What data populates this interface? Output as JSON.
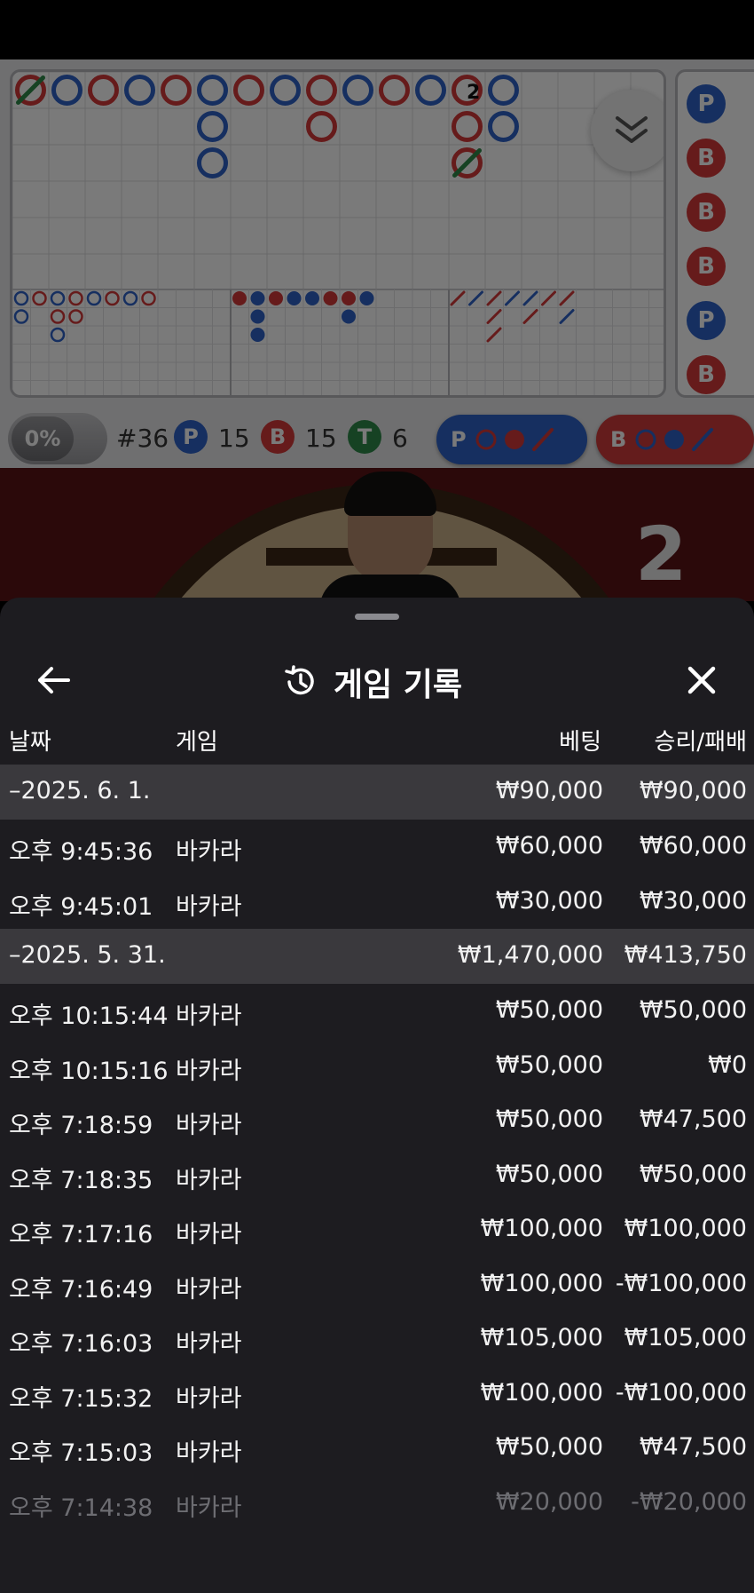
{
  "stats": {
    "percent": "0%",
    "round": "#36",
    "player_letter": "P",
    "player_count": "15",
    "banker_letter": "B",
    "banker_count": "15",
    "tie_letter": "T",
    "tie_count": "6"
  },
  "predict": {
    "player_label": "P",
    "banker_label": "B"
  },
  "road": {
    "tie_count_label": "2",
    "side_column": [
      "P",
      "B",
      "B",
      "B",
      "P",
      "B"
    ]
  },
  "video": {
    "countdown": "2"
  },
  "panel": {
    "title": "게임 기록",
    "columns": {
      "date": "날짜",
      "game": "게임",
      "bet": "베팅",
      "result": "승리/패배"
    },
    "rows": [
      {
        "type": "group",
        "date": "–2025. 6. 1.",
        "game": "",
        "bet": "₩90,000",
        "result": "₩90,000"
      },
      {
        "type": "item",
        "date": "오후 9:45:36",
        "game": "바카라",
        "bet": "₩60,000",
        "result": "₩60,000"
      },
      {
        "type": "item",
        "date": "오후 9:45:01",
        "game": "바카라",
        "bet": "₩30,000",
        "result": "₩30,000"
      },
      {
        "type": "group",
        "date": "–2025. 5. 31.",
        "game": "",
        "bet": "₩1,470,000",
        "result": "₩413,750"
      },
      {
        "type": "item",
        "date": "오후 10:15:44",
        "game": "바카라",
        "bet": "₩50,000",
        "result": "₩50,000"
      },
      {
        "type": "item",
        "date": "오후 10:15:16",
        "game": "바카라",
        "bet": "₩50,000",
        "result": "₩0"
      },
      {
        "type": "item",
        "date": "오후 7:18:59",
        "game": "바카라",
        "bet": "₩50,000",
        "result": "₩47,500"
      },
      {
        "type": "item",
        "date": "오후 7:18:35",
        "game": "바카라",
        "bet": "₩50,000",
        "result": "₩50,000"
      },
      {
        "type": "item",
        "date": "오후 7:17:16",
        "game": "바카라",
        "bet": "₩100,000",
        "result": "₩100,000"
      },
      {
        "type": "item",
        "date": "오후 7:16:49",
        "game": "바카라",
        "bet": "₩100,000",
        "result": "-₩100,000"
      },
      {
        "type": "item",
        "date": "오후 7:16:03",
        "game": "바카라",
        "bet": "₩105,000",
        "result": "₩105,000"
      },
      {
        "type": "item",
        "date": "오후 7:15:32",
        "game": "바카라",
        "bet": "₩100,000",
        "result": "-₩100,000"
      },
      {
        "type": "item",
        "date": "오후 7:15:03",
        "game": "바카라",
        "bet": "₩50,000",
        "result": "₩47,500"
      },
      {
        "type": "item",
        "date": "오후 7:14:38",
        "game": "바카라",
        "bet": "₩20,000",
        "result": "-₩20,000",
        "faded": true
      }
    ]
  },
  "colors": {
    "player": "#2f62c8",
    "banker": "#d53a3a",
    "tie": "#2e8b4a",
    "panel_bg": "#1d1c20",
    "group_bg": "#3a393d"
  }
}
